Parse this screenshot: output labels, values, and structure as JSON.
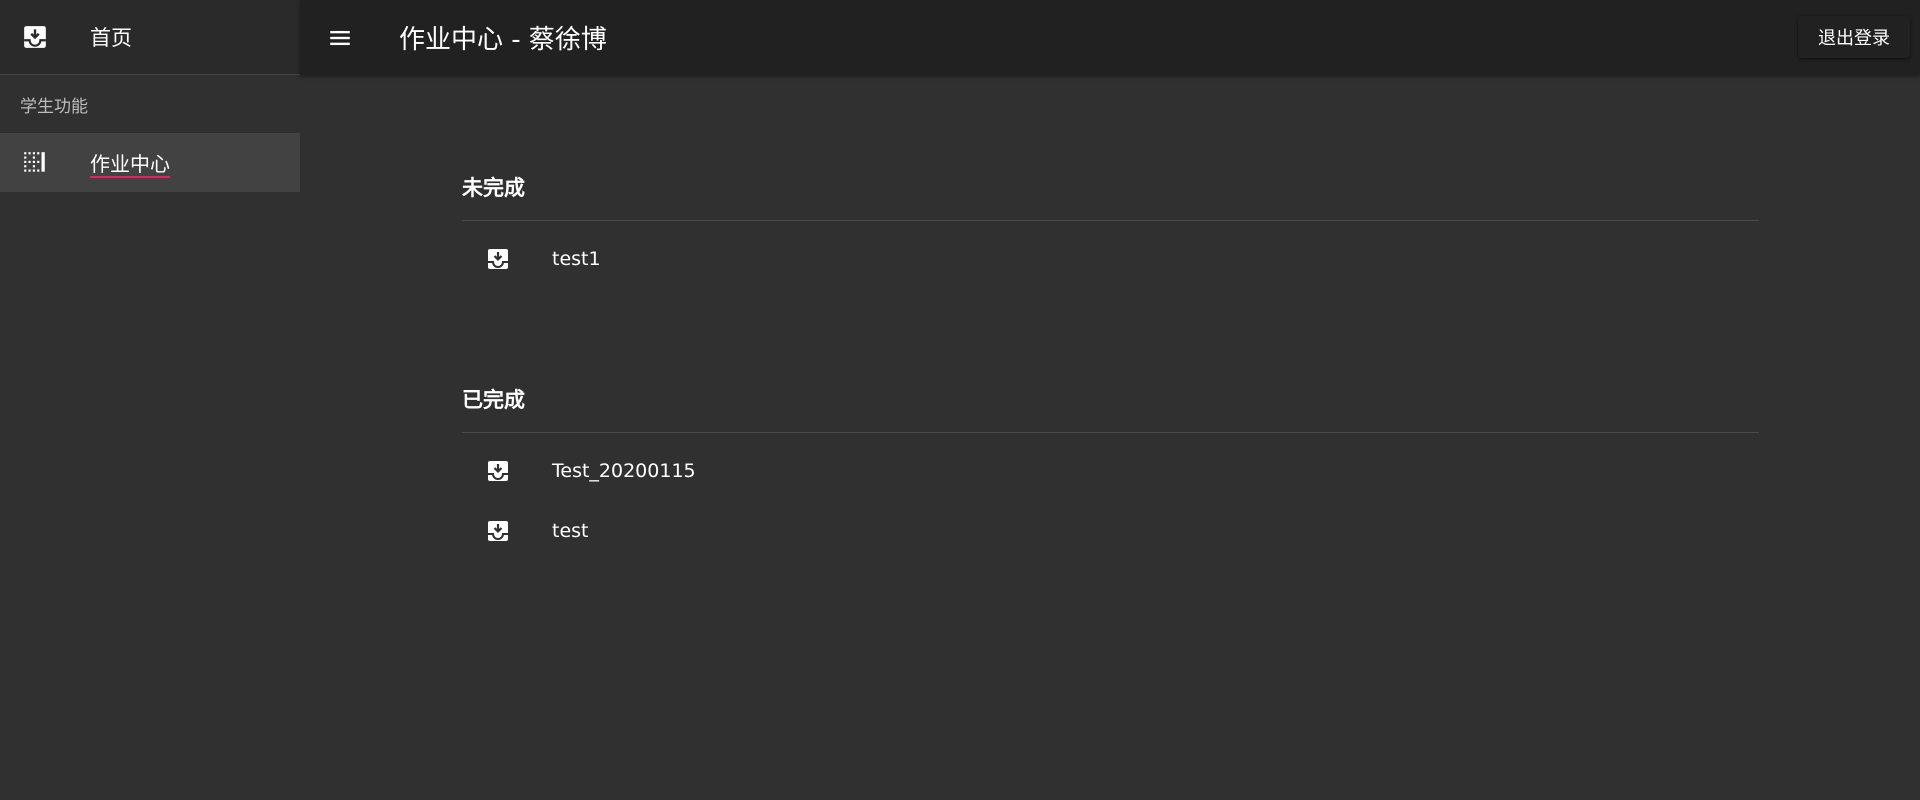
{
  "sidebar": {
    "home": {
      "label": "首页",
      "icon": "inbox-download-icon"
    },
    "section_label": "学生功能",
    "items": [
      {
        "label": "作业中心",
        "icon": "grid-dotted-icon"
      }
    ]
  },
  "appbar": {
    "menu_icon": "menu-icon",
    "title": "作业中心 - 蔡徐博",
    "logout_label": "退出登录"
  },
  "main": {
    "groups": [
      {
        "title": "未完成",
        "items": [
          {
            "label": "test1",
            "icon": "inbox-download-icon"
          }
        ]
      },
      {
        "title": "已完成",
        "items": [
          {
            "label": "Test_20200115",
            "icon": "inbox-download-icon"
          },
          {
            "label": "test",
            "icon": "inbox-download-icon"
          }
        ]
      }
    ]
  },
  "colors": {
    "background": "#303030",
    "appbar": "#212121",
    "sidebar_active": "#424242",
    "accent_underline": "#e91e63"
  }
}
